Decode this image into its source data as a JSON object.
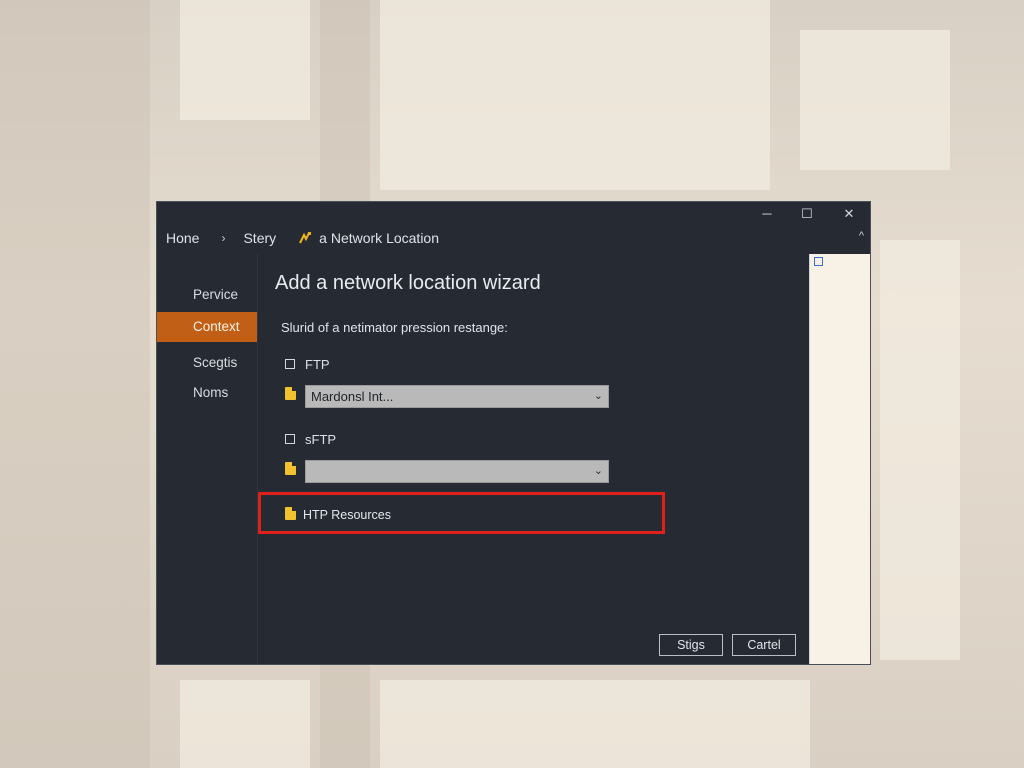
{
  "window": {
    "controls": {
      "minimize": "─",
      "maximize": "☐",
      "close": "✕"
    },
    "breadcrumb": {
      "home": "Hone",
      "separator": "›",
      "second": "Stery",
      "current": "a Network Location"
    },
    "collapse_glyph": "^"
  },
  "sidebar": {
    "items": [
      {
        "label": "Pervice",
        "active": false
      },
      {
        "label": "Context",
        "active": true
      },
      {
        "label": "Scegtis",
        "active": false
      },
      {
        "label": "Noms",
        "active": false
      }
    ]
  },
  "wizard": {
    "title": "Add a network location wizard",
    "prompt": "Slurid of a netimator pression restange:",
    "options": [
      {
        "label": "FTP",
        "checked": false,
        "select_value": "Mardonsl Int..."
      },
      {
        "label": "sFTP",
        "checked": false,
        "select_value": ""
      }
    ],
    "http_option": {
      "label": "HTP Resources",
      "highlighted": true
    },
    "buttons": {
      "primary": "Stigs",
      "cancel": "Cartel"
    }
  },
  "colors": {
    "accent": "#c25f17",
    "highlight": "#e0201a",
    "window_bg": "#262b33",
    "file_icon": "#f2c12e"
  }
}
